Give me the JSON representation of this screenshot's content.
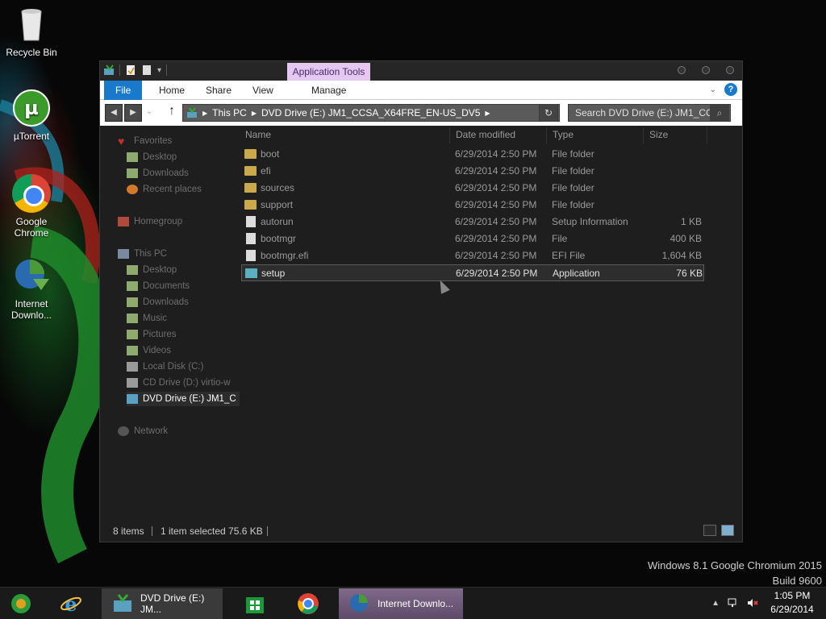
{
  "desktop": {
    "icons": [
      {
        "label": "Recycle Bin",
        "icon": "recycle-bin-icon"
      },
      {
        "label": "µTorrent",
        "icon": "utorrent-icon"
      },
      {
        "label": "Google\nChrome",
        "label_line1": "Google",
        "label_line2": "Chrome",
        "icon": "chrome-icon"
      },
      {
        "label_line1": "Internet",
        "label_line2": "Downlo...",
        "icon": "internet-download-manager-icon"
      }
    ],
    "watermark_line1": "Windows 8.1 Google Chromium 2015",
    "watermark_line2": "Build 9600"
  },
  "window": {
    "contextual_tab_group": "Application Tools",
    "ribbon_tabs": [
      "File",
      "Home",
      "Share",
      "View",
      "Manage"
    ],
    "address": {
      "segments": [
        "This PC",
        "DVD Drive (E:) JM1_CCSA_X64FRE_EN-US_DV5"
      ]
    },
    "search": {
      "placeholder": "Search DVD Drive (E:) JM1_CC..."
    },
    "nav_pane": {
      "favorites": "Favorites",
      "favorites_items": [
        "Desktop",
        "Downloads",
        "Recent places"
      ],
      "homegroup": "Homegroup",
      "this_pc": "This PC",
      "this_pc_items": [
        "Desktop",
        "Documents",
        "Downloads",
        "Music",
        "Pictures",
        "Videos",
        "Local Disk (C:)",
        "CD Drive (D:) virtio-w",
        "DVD Drive (E:) JM1_C"
      ],
      "network": "Network"
    },
    "columns": [
      "Name",
      "Date modified",
      "Type",
      "Size"
    ],
    "files": [
      {
        "name": "boot",
        "date": "6/29/2014 2:50 PM",
        "type": "File folder",
        "size": "",
        "kind": "folder"
      },
      {
        "name": "efi",
        "date": "6/29/2014 2:50 PM",
        "type": "File folder",
        "size": "",
        "kind": "folder"
      },
      {
        "name": "sources",
        "date": "6/29/2014 2:50 PM",
        "type": "File folder",
        "size": "",
        "kind": "folder"
      },
      {
        "name": "support",
        "date": "6/29/2014 2:50 PM",
        "type": "File folder",
        "size": "",
        "kind": "folder"
      },
      {
        "name": "autorun",
        "date": "6/29/2014 2:50 PM",
        "type": "Setup Information",
        "size": "1 KB",
        "kind": "doc"
      },
      {
        "name": "bootmgr",
        "date": "6/29/2014 2:50 PM",
        "type": "File",
        "size": "400 KB",
        "kind": "doc"
      },
      {
        "name": "bootmgr.efi",
        "date": "6/29/2014 2:50 PM",
        "type": "EFI File",
        "size": "1,604 KB",
        "kind": "doc"
      },
      {
        "name": "setup",
        "date": "6/29/2014 2:50 PM",
        "type": "Application",
        "size": "76 KB",
        "kind": "app",
        "selected": true
      }
    ],
    "status": {
      "count": "8 items",
      "selection": "1 item selected  75.6 KB"
    }
  },
  "taskbar": {
    "items": [
      {
        "label": "",
        "icon": "media-center-icon"
      },
      {
        "label": "",
        "icon": "internet-explorer-icon"
      },
      {
        "label": "DVD Drive (E:) JM...",
        "icon": "file-explorer-icon",
        "active": true
      },
      {
        "label": "",
        "icon": "store-icon"
      },
      {
        "label": "",
        "icon": "chrome-icon"
      },
      {
        "label": "Internet Downlo...",
        "icon": "internet-download-manager-icon",
        "active": true
      }
    ],
    "clock_time": "1:05 PM",
    "clock_date": "6/29/2014"
  },
  "colors": {
    "file_tab": "#1979ca",
    "app_tools_tab": "#e4c8f0",
    "window_bg": "#1e1e1e"
  }
}
